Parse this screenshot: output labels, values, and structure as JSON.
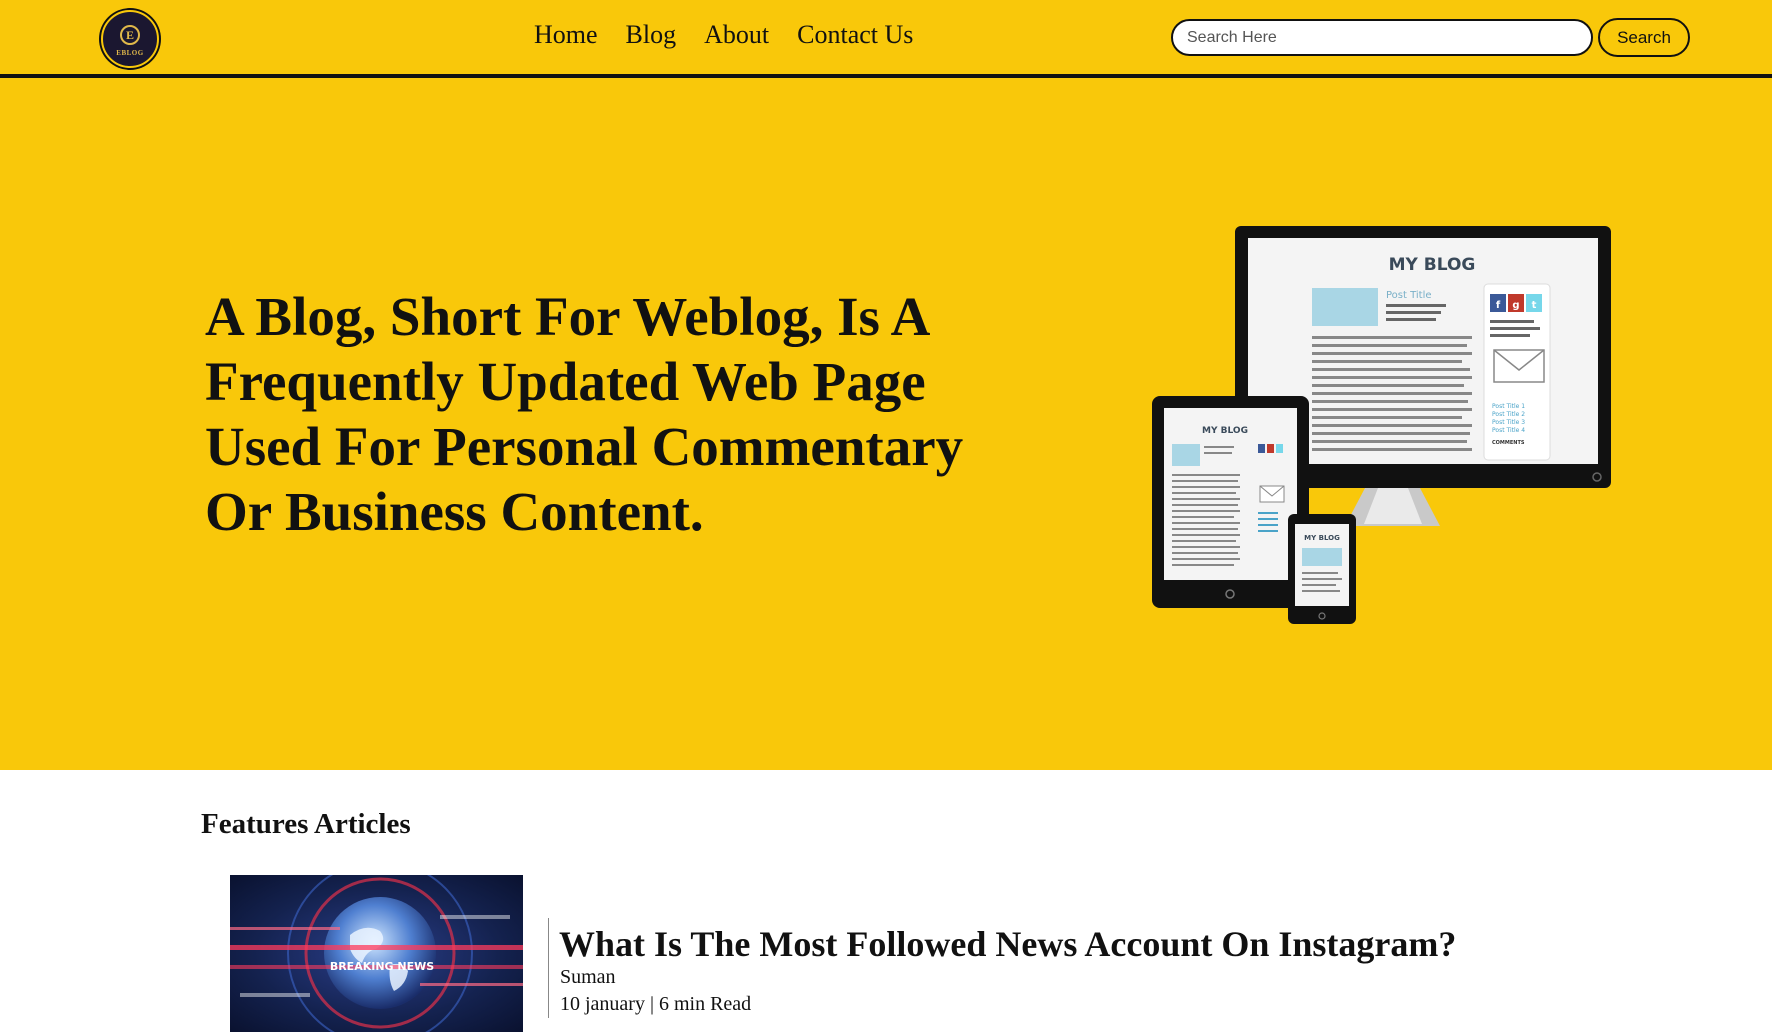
{
  "header": {
    "logo": {
      "letter": "E",
      "text": "EBLOG"
    },
    "nav": [
      {
        "label": "Home"
      },
      {
        "label": "Blog"
      },
      {
        "label": "About"
      },
      {
        "label": "Contact Us"
      }
    ],
    "search": {
      "placeholder": "Search Here",
      "value": "",
      "button_label": "Search"
    }
  },
  "hero": {
    "title": "A Blog, Short For Weblog, Is A Frequently Updated Web Page Used For Personal Commentary Or Business Content.",
    "illustration": {
      "heading": "MY BLOG",
      "post_title": "Post Title",
      "social": [
        "f",
        "g",
        "t"
      ],
      "links": [
        "Post Title 1",
        "Post Title 2",
        "Post Title 3",
        "Post Title 4"
      ],
      "comments_label": "COMMENTS"
    }
  },
  "features": {
    "heading": "Features Articles",
    "articles": [
      {
        "image_caption": "BREAKING NEWS",
        "title": "What Is The Most Followed News Account On Instagram?",
        "author": "Suman",
        "date": "10 january",
        "read_time": "6 min Read",
        "meta": "10 january | 6 min Read"
      }
    ]
  },
  "colors": {
    "brand_yellow": "#f9c80a",
    "text": "#111111",
    "background": "#ffffff"
  }
}
